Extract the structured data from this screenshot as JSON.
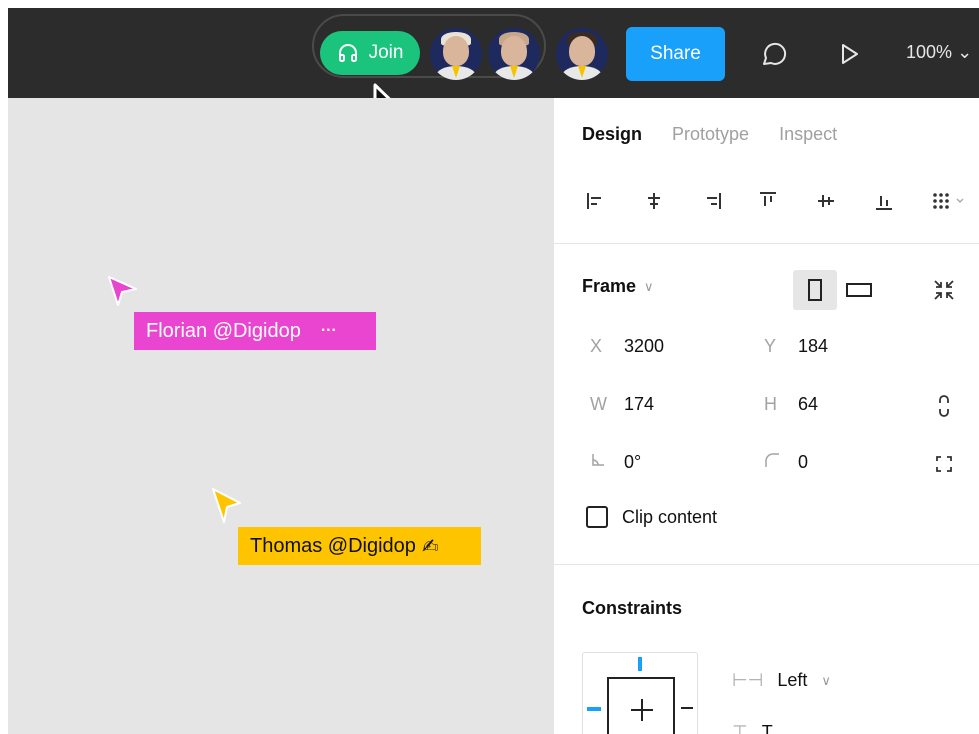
{
  "toolbar": {
    "join_label": "Join",
    "share_label": "Share",
    "zoom_level": "100%",
    "avatars": [
      {
        "name": "collaborator-1",
        "hair": "#e9e3d6"
      },
      {
        "name": "collaborator-2",
        "hair": "#c8a68c"
      },
      {
        "name": "collaborator-3",
        "hair": "#3a2b22"
      }
    ]
  },
  "canvas": {
    "cursors": [
      {
        "label": "Florian @Digidop",
        "extra": "···",
        "color": "#e945d1"
      },
      {
        "label": "Thomas @Digidop",
        "extra": "✍",
        "color": "#ffc400"
      }
    ]
  },
  "panel": {
    "tabs": [
      {
        "label": "Design",
        "active": true
      },
      {
        "label": "Prototype",
        "active": false
      },
      {
        "label": "Inspect",
        "active": false
      }
    ],
    "frame": {
      "label": "Frame",
      "x_label": "X",
      "x": "3200",
      "y_label": "Y",
      "y": "184",
      "w_label": "W",
      "w": "174",
      "h_label": "H",
      "h": "64",
      "rotation": "0°",
      "radius": "0",
      "clip_label": "Clip content"
    },
    "constraints": {
      "title": "Constraints",
      "horizontal": "Left",
      "vertical": "T"
    }
  },
  "colors": {
    "join_green": "#1bc47d",
    "share_blue": "#18a0fb",
    "topbar": "#2c2c2c",
    "canvas_bg": "#e5e5e5"
  }
}
